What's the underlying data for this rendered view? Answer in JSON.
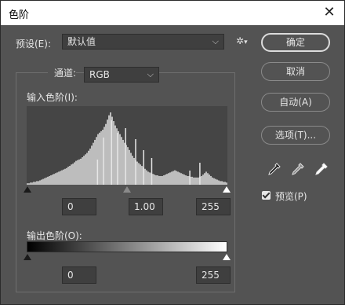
{
  "dialog": {
    "title": "色阶",
    "close_glyph": "✕",
    "preset_label": "预设(E):",
    "preset_value": "默认值",
    "preset_options_icon": "gear-icon",
    "channel_label": "通道:",
    "channel_value": "RGB",
    "input_levels_label": "输入色阶(I):",
    "input_black": "0",
    "input_gamma": "1.00",
    "input_white": "255",
    "output_levels_label": "输出色阶(O):",
    "output_black": "0",
    "output_white": "255",
    "buttons": {
      "ok": "确定",
      "cancel": "取消",
      "auto": "自动(A)",
      "options": "选项(T)..."
    },
    "preview_label": "预览(P)",
    "preview_checked": true,
    "eyedroppers": [
      "black-eyedropper-icon",
      "gray-eyedropper-icon",
      "white-eyedropper-icon"
    ]
  },
  "histogram": {
    "bins": [
      2,
      2,
      3,
      3,
      4,
      4,
      5,
      5,
      6,
      7,
      8,
      9,
      10,
      11,
      12,
      13,
      14,
      15,
      16,
      17,
      18,
      19,
      20,
      21,
      22,
      23,
      25,
      26,
      28,
      29,
      31,
      33,
      34,
      35,
      36,
      38,
      40,
      42,
      44,
      47,
      50,
      54,
      58,
      62,
      66,
      70,
      72,
      74,
      76,
      80,
      84,
      90,
      96,
      100,
      94,
      88,
      82,
      78,
      74,
      70,
      66,
      62,
      58,
      55,
      52,
      48,
      44,
      40,
      37,
      34,
      32,
      30,
      28,
      26,
      24,
      22,
      20,
      18,
      17,
      16,
      15,
      14,
      13,
      13,
      12,
      12,
      12,
      13,
      14,
      15,
      16,
      17,
      18,
      19,
      20,
      19,
      18,
      17,
      16,
      15,
      14,
      13,
      12,
      12,
      11,
      11,
      10,
      10,
      10,
      10,
      11,
      12,
      14,
      16,
      18,
      16,
      14,
      12,
      10,
      9,
      8,
      7,
      6,
      5,
      5,
      4,
      4,
      3
    ],
    "spikes": [
      {
        "pos": 0.42,
        "height": 82
      },
      {
        "pos": 0.49,
        "height": 72
      },
      {
        "pos": 0.54,
        "height": 58
      },
      {
        "pos": 0.45,
        "height": 66
      },
      {
        "pos": 0.38,
        "height": 60
      },
      {
        "pos": 0.58,
        "height": 44
      },
      {
        "pos": 0.35,
        "height": 32
      },
      {
        "pos": 0.62,
        "height": 34
      },
      {
        "pos": 0.81,
        "height": 18
      },
      {
        "pos": 0.86,
        "height": 28
      }
    ]
  }
}
